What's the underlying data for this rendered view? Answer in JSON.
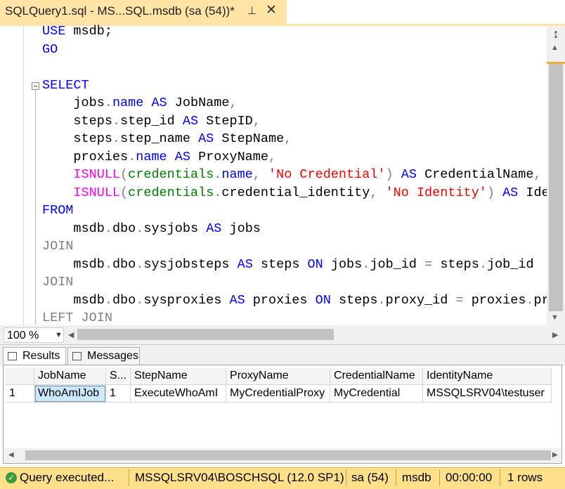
{
  "tab": {
    "title": "SQLQuery1.sql - MS...SQL.msdb (sa (54))*",
    "pin_icon": "pin-icon",
    "close_icon": "close-icon"
  },
  "editor": {
    "lines": [
      {
        "parts": [
          {
            "t": "USE ",
            "c": "kw"
          },
          {
            "t": "msdb;",
            "c": ""
          }
        ]
      },
      {
        "parts": [
          {
            "t": "GO",
            "c": "kw"
          }
        ]
      },
      {
        "parts": []
      },
      {
        "parts": [
          {
            "t": "SELECT",
            "c": "kw"
          }
        ]
      },
      {
        "parts": [
          {
            "t": "    jobs",
            "c": ""
          },
          {
            "t": ".",
            "c": "gr"
          },
          {
            "t": "name ",
            "c": "kw"
          },
          {
            "t": "AS ",
            "c": "kw"
          },
          {
            "t": "JobName",
            "c": ""
          },
          {
            "t": ",",
            "c": "gr"
          }
        ]
      },
      {
        "parts": [
          {
            "t": "    steps",
            "c": ""
          },
          {
            "t": ".",
            "c": "gr"
          },
          {
            "t": "step_id ",
            "c": ""
          },
          {
            "t": "AS ",
            "c": "kw"
          },
          {
            "t": "StepID",
            "c": ""
          },
          {
            "t": ",",
            "c": "gr"
          }
        ]
      },
      {
        "parts": [
          {
            "t": "    steps",
            "c": ""
          },
          {
            "t": ".",
            "c": "gr"
          },
          {
            "t": "step_name ",
            "c": ""
          },
          {
            "t": "AS ",
            "c": "kw"
          },
          {
            "t": "StepName",
            "c": ""
          },
          {
            "t": ",",
            "c": "gr"
          }
        ]
      },
      {
        "parts": [
          {
            "t": "    proxies",
            "c": ""
          },
          {
            "t": ".",
            "c": "gr"
          },
          {
            "t": "name ",
            "c": "kw"
          },
          {
            "t": "AS ",
            "c": "kw"
          },
          {
            "t": "ProxyName",
            "c": ""
          },
          {
            "t": ",",
            "c": "gr"
          }
        ]
      },
      {
        "parts": [
          {
            "t": "    ISNULL",
            "c": "fn"
          },
          {
            "t": "(",
            "c": "gr"
          },
          {
            "t": "credentials",
            "c": "sy"
          },
          {
            "t": ".",
            "c": "gr"
          },
          {
            "t": "name",
            "c": "kw"
          },
          {
            "t": ", ",
            "c": "gr"
          },
          {
            "t": "'No Credential'",
            "c": "st"
          },
          {
            "t": ") ",
            "c": "gr"
          },
          {
            "t": "AS ",
            "c": "kw"
          },
          {
            "t": "CredentialName",
            "c": ""
          },
          {
            "t": ",",
            "c": "gr"
          }
        ]
      },
      {
        "parts": [
          {
            "t": "    ISNULL",
            "c": "fn"
          },
          {
            "t": "(",
            "c": "gr"
          },
          {
            "t": "credentials",
            "c": "sy"
          },
          {
            "t": ".",
            "c": "gr"
          },
          {
            "t": "credential_identity",
            "c": ""
          },
          {
            "t": ", ",
            "c": "gr"
          },
          {
            "t": "'No Identity'",
            "c": "st"
          },
          {
            "t": ") ",
            "c": "gr"
          },
          {
            "t": "AS ",
            "c": "kw"
          },
          {
            "t": "Ide",
            "c": ""
          }
        ]
      },
      {
        "parts": [
          {
            "t": "FROM",
            "c": "kw"
          }
        ]
      },
      {
        "parts": [
          {
            "t": "    msdb",
            "c": ""
          },
          {
            "t": ".",
            "c": "gr"
          },
          {
            "t": "dbo",
            "c": ""
          },
          {
            "t": ".",
            "c": "gr"
          },
          {
            "t": "sysjobs ",
            "c": ""
          },
          {
            "t": "AS ",
            "c": "kw"
          },
          {
            "t": "jobs",
            "c": ""
          }
        ]
      },
      {
        "parts": [
          {
            "t": "JOIN",
            "c": "gr"
          }
        ]
      },
      {
        "parts": [
          {
            "t": "    msdb",
            "c": ""
          },
          {
            "t": ".",
            "c": "gr"
          },
          {
            "t": "dbo",
            "c": ""
          },
          {
            "t": ".",
            "c": "gr"
          },
          {
            "t": "sysjobsteps ",
            "c": ""
          },
          {
            "t": "AS ",
            "c": "kw"
          },
          {
            "t": "steps ",
            "c": ""
          },
          {
            "t": "ON ",
            "c": "kw"
          },
          {
            "t": "jobs",
            "c": ""
          },
          {
            "t": ".",
            "c": "gr"
          },
          {
            "t": "job_id ",
            "c": ""
          },
          {
            "t": "= ",
            "c": "gr"
          },
          {
            "t": "steps",
            "c": ""
          },
          {
            "t": ".",
            "c": "gr"
          },
          {
            "t": "job_id",
            "c": ""
          }
        ]
      },
      {
        "parts": [
          {
            "t": "JOIN",
            "c": "gr"
          }
        ]
      },
      {
        "parts": [
          {
            "t": "    msdb",
            "c": ""
          },
          {
            "t": ".",
            "c": "gr"
          },
          {
            "t": "dbo",
            "c": ""
          },
          {
            "t": ".",
            "c": "gr"
          },
          {
            "t": "sysproxies ",
            "c": ""
          },
          {
            "t": "AS ",
            "c": "kw"
          },
          {
            "t": "proxies ",
            "c": ""
          },
          {
            "t": "ON ",
            "c": "kw"
          },
          {
            "t": "steps",
            "c": ""
          },
          {
            "t": ".",
            "c": "gr"
          },
          {
            "t": "proxy_id ",
            "c": ""
          },
          {
            "t": "= ",
            "c": "gr"
          },
          {
            "t": "proxies",
            "c": ""
          },
          {
            "t": ".",
            "c": "gr"
          },
          {
            "t": "pr",
            "c": ""
          }
        ]
      },
      {
        "parts": [
          {
            "t": "LEFT JOIN",
            "c": "gr"
          }
        ]
      }
    ]
  },
  "zoom": {
    "value": "100 %"
  },
  "results_tabs": {
    "results": "Results",
    "messages": "Messages"
  },
  "grid": {
    "columns": [
      "",
      "JobName",
      "S...",
      "StepName",
      "ProxyName",
      "CredentialName",
      "IdentityName"
    ],
    "rows": [
      [
        "1",
        "WhoAmIJob",
        "1",
        "ExecuteWhoAmI",
        "MyCredentialProxy",
        "MyCredential",
        "MSSQLSRV04\\testuser"
      ]
    ]
  },
  "status": {
    "message": "Query  executed...",
    "server": "MSSQLSRV04\\BOSCHSQL (12.0 SP1)",
    "user": "sa (54)",
    "database": "msdb",
    "elapsed": "00:00:00",
    "rows": "1 rows"
  },
  "colors": {
    "tab": "#ffe4a6",
    "status": "#ffe08a",
    "keyword": "#0000ff",
    "function": "#ff00ff",
    "string": "#ff0000",
    "system": "#008000"
  }
}
